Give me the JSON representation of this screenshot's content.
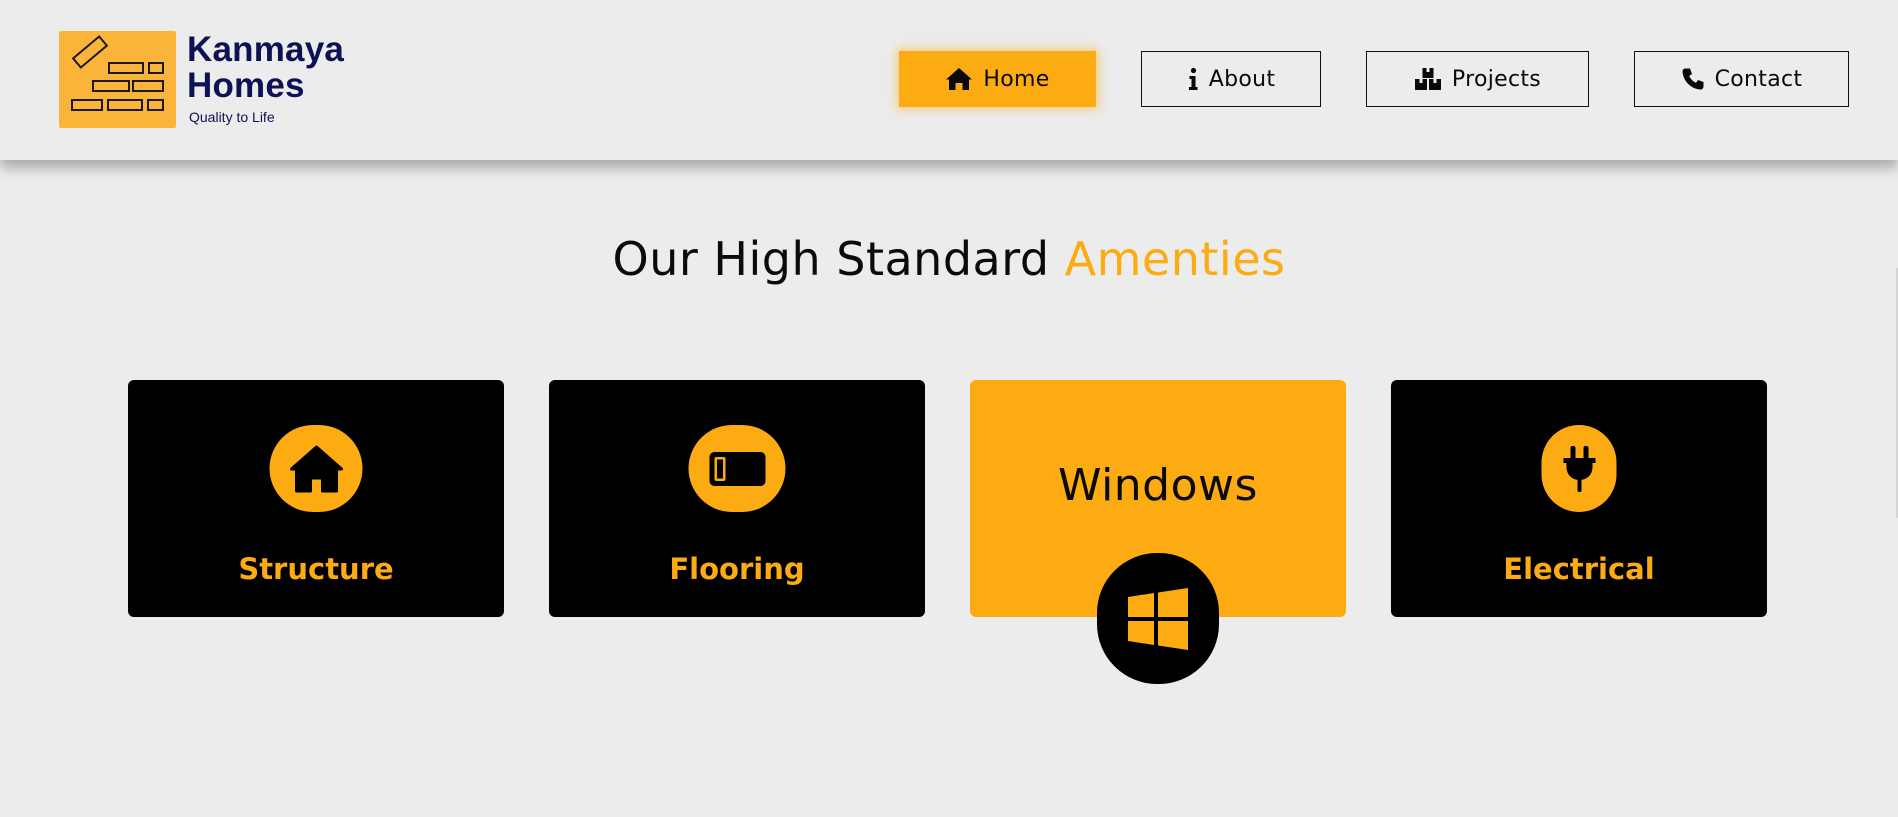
{
  "brand": {
    "name_line1": "Kanmaya",
    "name_line2": "Homes",
    "tagline": "Quality to Life",
    "logo_icon": "bricks-icon"
  },
  "nav": {
    "items": [
      {
        "label": "Home",
        "icon": "home-icon",
        "active": true
      },
      {
        "label": "About",
        "icon": "info-icon",
        "active": false
      },
      {
        "label": "Projects",
        "icon": "boxes-icon",
        "active": false
      },
      {
        "label": "Contact",
        "icon": "phone-icon",
        "active": false
      }
    ]
  },
  "section": {
    "title_main": "Our High Standard",
    "title_accent": "Amenties"
  },
  "cards": [
    {
      "label": "Structure",
      "icon": "house-icon",
      "active": false
    },
    {
      "label": "Flooring",
      "icon": "floor-tile-icon",
      "active": false
    },
    {
      "label": "Windows",
      "icon": "windows-icon",
      "active": true
    },
    {
      "label": "Electrical",
      "icon": "plug-icon",
      "active": false
    }
  ],
  "colors": {
    "accent": "#fcab13",
    "logo_bg": "#fbb43a",
    "brand_navy": "#0d1254",
    "background": "#ececec",
    "card_bg": "#000000"
  }
}
